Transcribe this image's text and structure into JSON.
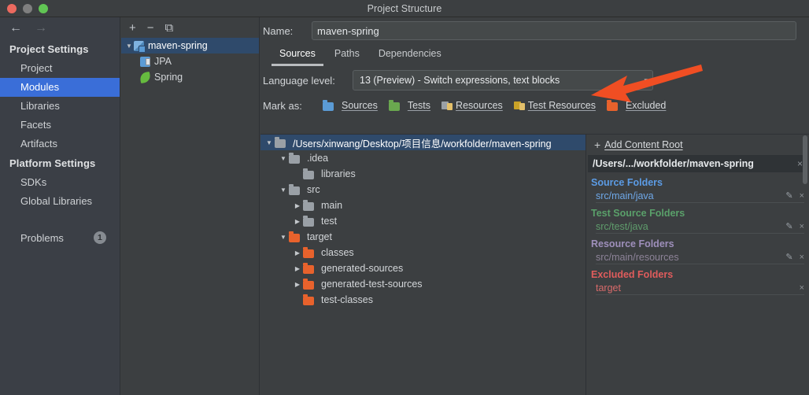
{
  "window": {
    "title": "Project Structure",
    "controls": {
      "close": "close-button",
      "minimize": "minimize-button",
      "zoom": "zoom-button"
    }
  },
  "sidebar": {
    "back_arrow": "←",
    "forward_arrow": "→",
    "groups": [
      {
        "title": "Project Settings",
        "items": [
          {
            "label": "Project",
            "selected": false
          },
          {
            "label": "Modules",
            "selected": true
          },
          {
            "label": "Libraries",
            "selected": false
          },
          {
            "label": "Facets",
            "selected": false
          },
          {
            "label": "Artifacts",
            "selected": false
          }
        ]
      },
      {
        "title": "Platform Settings",
        "items": [
          {
            "label": "SDKs",
            "selected": false
          },
          {
            "label": "Global Libraries",
            "selected": false
          }
        ]
      }
    ],
    "problems": {
      "label": "Problems",
      "count": "1"
    }
  },
  "modules_panel": {
    "toolbar": {
      "add": "+",
      "remove": "−",
      "copy": "⧉"
    },
    "tree": [
      {
        "label": "maven-spring",
        "twisty": "▼",
        "icon": "module-icon",
        "selected": true,
        "indent": 0
      },
      {
        "label": "JPA",
        "twisty": "",
        "icon": "jpa-icon",
        "selected": false,
        "indent": 1
      },
      {
        "label": "Spring",
        "twisty": "",
        "icon": "spring-icon",
        "selected": false,
        "indent": 1
      }
    ]
  },
  "main": {
    "name": {
      "label": "Name:",
      "value": "maven-spring"
    },
    "tabs": [
      {
        "label": "Sources",
        "active": true
      },
      {
        "label": "Paths",
        "active": false
      },
      {
        "label": "Dependencies",
        "active": false
      }
    ],
    "language_level": {
      "label": "Language level:",
      "value": "13 (Preview) - Switch expressions, text blocks",
      "caret": "▾"
    },
    "mark_as": {
      "label": "Mark as:",
      "buttons": [
        {
          "label": "Sources",
          "color": "#5b9bd5",
          "kind": "folder"
        },
        {
          "label": "Tests",
          "color": "#6aa84f",
          "kind": "folder"
        },
        {
          "label": "Resources",
          "color": "#9aa0a6",
          "kind": "resource"
        },
        {
          "label": "Test Resources",
          "color": "#c9a227",
          "kind": "test-resource"
        },
        {
          "label": "Excluded",
          "color": "#e8622c",
          "kind": "folder"
        }
      ]
    },
    "content_tree": [
      {
        "label": "/Users/xinwang/Desktop/项目信息/workfolder/maven-spring",
        "twisty": "▼",
        "indent": 0,
        "color": "gray",
        "selected": true
      },
      {
        "label": ".idea",
        "twisty": "▼",
        "indent": 1,
        "color": "gray",
        "selected": false
      },
      {
        "label": "libraries",
        "twisty": "",
        "indent": 2,
        "color": "gray",
        "selected": false
      },
      {
        "label": "src",
        "twisty": "▼",
        "indent": 1,
        "color": "gray",
        "selected": false
      },
      {
        "label": "main",
        "twisty": "▶",
        "indent": 2,
        "color": "gray",
        "selected": false
      },
      {
        "label": "test",
        "twisty": "▶",
        "indent": 2,
        "color": "gray",
        "selected": false
      },
      {
        "label": "target",
        "twisty": "▼",
        "indent": 1,
        "color": "orange",
        "selected": false
      },
      {
        "label": "classes",
        "twisty": "▶",
        "indent": 2,
        "color": "orange",
        "selected": false
      },
      {
        "label": "generated-sources",
        "twisty": "▶",
        "indent": 2,
        "color": "orange",
        "selected": false
      },
      {
        "label": "generated-test-sources",
        "twisty": "▶",
        "indent": 2,
        "color": "orange",
        "selected": false
      },
      {
        "label": "test-classes",
        "twisty": "",
        "indent": 2,
        "color": "orange",
        "selected": false
      }
    ],
    "right_panel": {
      "add_content_root": "Add Content Root",
      "add_plus": "+",
      "root_path": "/Users/.../workfolder/maven-spring",
      "root_close": "×",
      "sections": [
        {
          "title": "Source Folders",
          "color_class": "blue",
          "rows": [
            {
              "path": "src/main/java",
              "edit": "✎",
              "remove": "×"
            }
          ]
        },
        {
          "title": "Test Source Folders",
          "color_class": "green",
          "rows": [
            {
              "path": "src/test/java",
              "edit": "✎",
              "remove": "×"
            }
          ]
        },
        {
          "title": "Resource Folders",
          "color_class": "purple",
          "rows": [
            {
              "path": "src/main/resources",
              "edit": "✎",
              "remove": "×"
            }
          ]
        },
        {
          "title": "Excluded Folders",
          "color_class": "red",
          "rows": [
            {
              "path": "target",
              "edit": "",
              "remove": "×"
            }
          ]
        }
      ]
    }
  },
  "annotation": {
    "arrow_color": "#f04e23"
  }
}
